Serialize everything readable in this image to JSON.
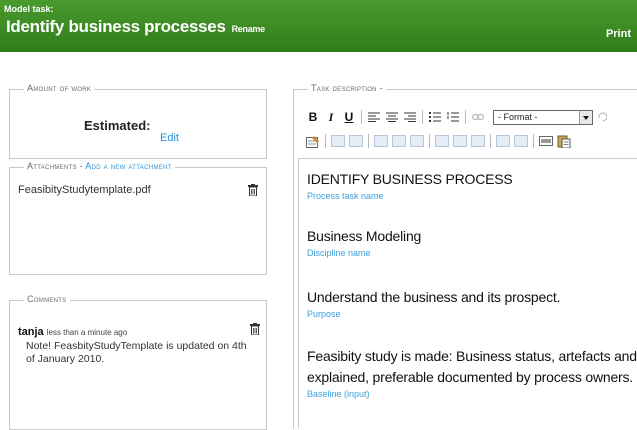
{
  "header": {
    "small_label": "Model task:",
    "title": "Identify business processes",
    "rename": "Rename",
    "print": "Print"
  },
  "amount_of_work": {
    "legend": "Amount of work",
    "estimated_label": "Estimated:",
    "edit": "Edit"
  },
  "attachments": {
    "legend": "Attachments",
    "separator": " - ",
    "add_link": "Add a new attachment",
    "items": [
      {
        "name": "FeasibityStudytemplate.pdf"
      }
    ]
  },
  "comments": {
    "legend": "Comments",
    "items": [
      {
        "user": "tanja",
        "time": "less than a minute ago",
        "text": "Note! FeasbityStudyTemplate is updated on 4th of January 2010."
      }
    ]
  },
  "task_description": {
    "legend": "Task description -",
    "toolbar": {
      "bold": "B",
      "italic": "I",
      "underline": "U",
      "format_value": "- Format -"
    },
    "content": [
      {
        "text": "IDENTIFY BUSINESS PROCESS",
        "caption": "Process task name"
      },
      {
        "text": "Business Modeling",
        "caption": "Discipline name"
      },
      {
        "text": "Understand the business and its prospect.",
        "caption": "Purpose"
      },
      {
        "text": "Feasibity study is made: Business status, artefacts and c",
        "text2": "explained, preferable documented by process owners.",
        "caption": "Baseline (input)"
      }
    ]
  }
}
